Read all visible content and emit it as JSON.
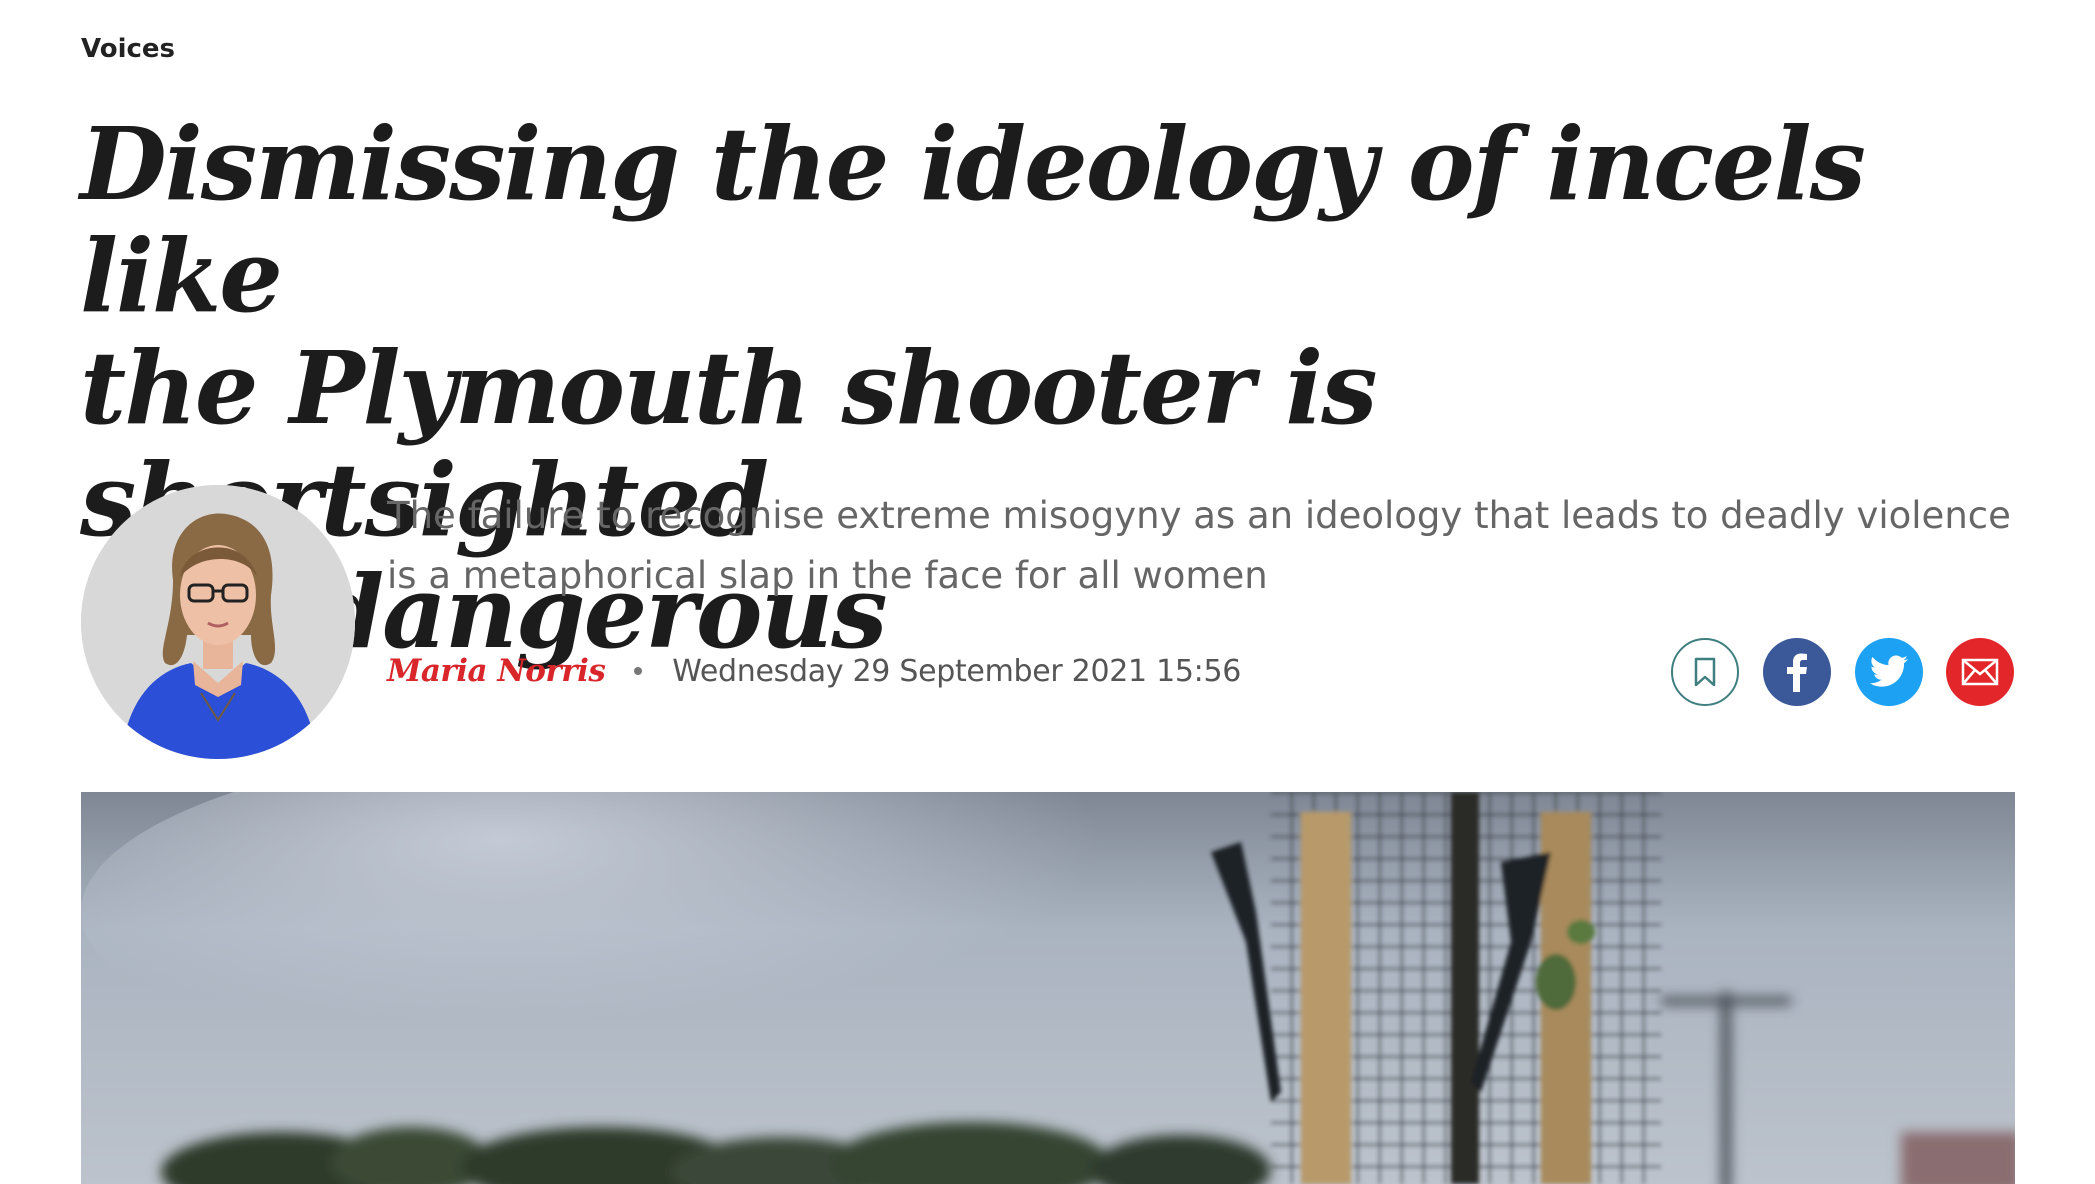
{
  "section": {
    "label": "Voices"
  },
  "article": {
    "headline_lines": [
      "Dismissing the ideology of incels like",
      "the Plymouth shooter is shortsighted",
      "and dangerous"
    ],
    "standfirst": "The failure to recognise extreme misogyny as an ideology that leads to deadly violence is a metaphorical slap in the face for all women",
    "author": "Maria Norris",
    "date": "Wednesday 29 September 2021 15:56"
  },
  "share_buttons": [
    {
      "name": "bookmark",
      "icon": "bookmark-icon",
      "color": "#3f7f7f"
    },
    {
      "name": "facebook",
      "icon": "facebook-icon",
      "color": "#3b5998"
    },
    {
      "name": "twitter",
      "icon": "twitter-icon",
      "color": "#1da1f2"
    },
    {
      "name": "email",
      "icon": "email-icon",
      "color": "#e3262a"
    }
  ],
  "colors": {
    "author": "#d8262b",
    "headline": "#1c1c1c",
    "standfirst": "#666666"
  }
}
